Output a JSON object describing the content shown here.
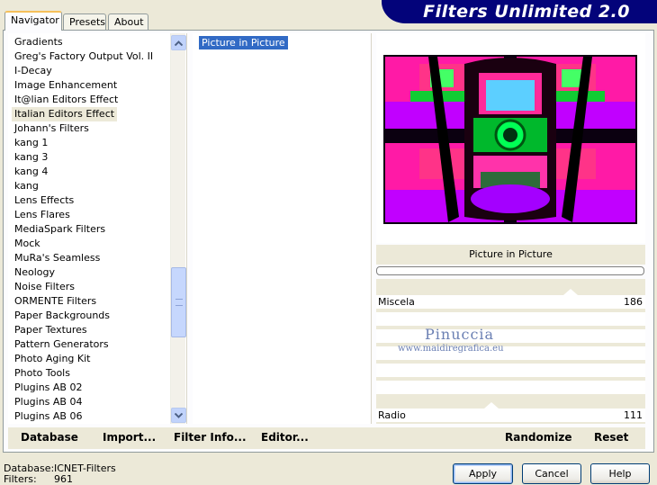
{
  "tabs": [
    {
      "label": "Navigator",
      "active": true
    },
    {
      "label": "Presets",
      "active": false
    },
    {
      "label": "About",
      "active": false
    }
  ],
  "banner": {
    "title": "Filters Unlimited 2.0",
    "color": "#03037A"
  },
  "categories": [
    {
      "label": "Gradients"
    },
    {
      "label": "Greg's Factory Output Vol. II"
    },
    {
      "label": "I-Decay"
    },
    {
      "label": "Image Enhancement"
    },
    {
      "label": "It@lian Editors Effect"
    },
    {
      "label": "Italian Editors Effect",
      "selected": true
    },
    {
      "label": "Johann's Filters"
    },
    {
      "label": "kang 1"
    },
    {
      "label": "kang 3"
    },
    {
      "label": "kang 4"
    },
    {
      "label": "kang"
    },
    {
      "label": "Lens Effects"
    },
    {
      "label": "Lens Flares"
    },
    {
      "label": "MediaSpark Filters"
    },
    {
      "label": "Mock"
    },
    {
      "label": "MuRa's Seamless"
    },
    {
      "label": "Neology"
    },
    {
      "label": "Noise Filters"
    },
    {
      "label": "ORMENTE Filters"
    },
    {
      "label": "Paper Backgrounds"
    },
    {
      "label": "Paper Textures"
    },
    {
      "label": "Pattern Generators"
    },
    {
      "label": "Photo Aging Kit"
    },
    {
      "label": "Photo Tools"
    },
    {
      "label": "Plugins AB 02"
    },
    {
      "label": "Plugins AB 04"
    },
    {
      "label": "Plugins AB 06"
    }
  ],
  "filters": [
    {
      "label": "Picture in Picture",
      "selected": true
    }
  ],
  "preview": {
    "filter_name": "Picture in Picture"
  },
  "params": [
    {
      "label": "Miscela",
      "value": "186"
    },
    {
      "label": "Radio",
      "value": "111"
    }
  ],
  "watermark": {
    "name": "Pinuccia",
    "url": "www.maidiregrafica.eu"
  },
  "actions": {
    "database": "Database",
    "import": "Import...",
    "filter_info": "Filter Info...",
    "editor": "Editor...",
    "randomize": "Randomize",
    "reset": "Reset"
  },
  "status": {
    "database_label": "Database:",
    "database_value": "ICNET-Filters",
    "filters_label": "Filters:",
    "filters_value": "961"
  },
  "buttons": {
    "apply": "Apply",
    "cancel": "Cancel",
    "help": "Help"
  },
  "colors": {
    "selection": "#316AC5",
    "dialog_bg": "#ECE9D8"
  }
}
